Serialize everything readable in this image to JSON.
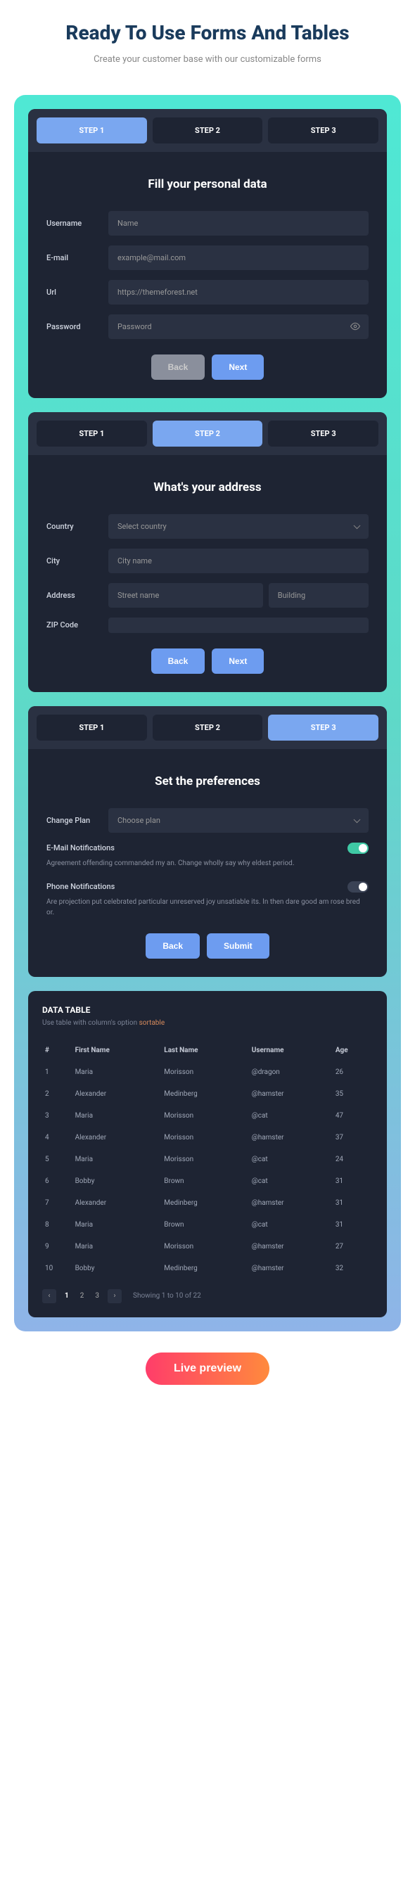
{
  "header": {
    "title": "Ready To Use Forms And Tables",
    "subtitle": "Create your customer base with our customizable forms"
  },
  "steps": {
    "s1": "STEP 1",
    "s2": "STEP 2",
    "s3": "STEP 3"
  },
  "card1": {
    "title": "Fill your personal data",
    "labels": {
      "username": "Username",
      "email": "E-mail",
      "url": "Url",
      "password": "Password"
    },
    "ph": {
      "username": "Name",
      "email": "example@mail.com",
      "url": "https://themeforest.net",
      "password": "Password"
    },
    "back": "Back",
    "next": "Next"
  },
  "card2": {
    "title": "What's your address",
    "labels": {
      "country": "Country",
      "city": "City",
      "address": "Address",
      "zip": "ZIP Code"
    },
    "ph": {
      "country": "Select country",
      "city": "City name",
      "street": "Street name",
      "building": "Building"
    },
    "back": "Back",
    "next": "Next"
  },
  "card3": {
    "title": "Set the preferences",
    "labels": {
      "plan": "Change Plan"
    },
    "ph": {
      "plan": "Choose plan"
    },
    "email_notif": {
      "label": "E-Mail Notifications",
      "desc": "Agreement offending commanded my an. Change wholly say why eldest period."
    },
    "phone_notif": {
      "label": "Phone Notifications",
      "desc": "Are projection put celebrated particular unreserved joy unsatiable its. In then dare good am rose bred or."
    },
    "back": "Back",
    "submit": "Submit"
  },
  "dt": {
    "title": "DATA TABLE",
    "sub_pre": "Use table with column's option ",
    "sub_hl": "sortable",
    "cols": {
      "idx": "#",
      "first": "First Name",
      "last": "Last Name",
      "user": "Username",
      "age": "Age"
    },
    "rows": [
      {
        "n": "1",
        "f": "Maria",
        "l": "Morisson",
        "u": "@dragon",
        "a": "26"
      },
      {
        "n": "2",
        "f": "Alexander",
        "l": "Medinberg",
        "u": "@hamster",
        "a": "35"
      },
      {
        "n": "3",
        "f": "Maria",
        "l": "Morisson",
        "u": "@cat",
        "a": "47"
      },
      {
        "n": "4",
        "f": "Alexander",
        "l": "Morisson",
        "u": "@hamster",
        "a": "37"
      },
      {
        "n": "5",
        "f": "Maria",
        "l": "Morisson",
        "u": "@cat",
        "a": "24"
      },
      {
        "n": "6",
        "f": "Bobby",
        "l": "Brown",
        "u": "@cat",
        "a": "31"
      },
      {
        "n": "7",
        "f": "Alexander",
        "l": "Medinberg",
        "u": "@hamster",
        "a": "31"
      },
      {
        "n": "8",
        "f": "Maria",
        "l": "Brown",
        "u": "@cat",
        "a": "31"
      },
      {
        "n": "9",
        "f": "Maria",
        "l": "Morisson",
        "u": "@hamster",
        "a": "27"
      },
      {
        "n": "10",
        "f": "Bobby",
        "l": "Medinberg",
        "u": "@hamster",
        "a": "32"
      }
    ],
    "pages": {
      "p1": "1",
      "p2": "2",
      "p3": "3"
    },
    "info": "Showing 1 to 10 of 22"
  },
  "live": "Live preview"
}
